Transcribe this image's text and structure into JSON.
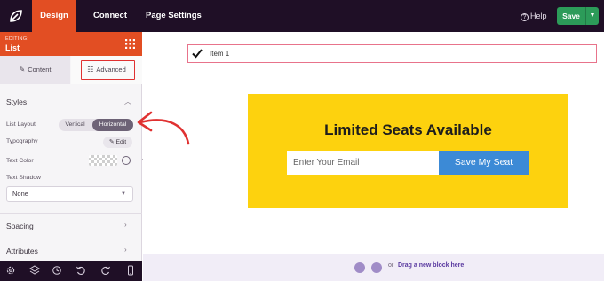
{
  "topbar": {
    "tabs": [
      {
        "label": "Design",
        "active": true
      },
      {
        "label": "Connect",
        "active": false
      },
      {
        "label": "Page Settings",
        "active": false
      }
    ],
    "help_label": "Help",
    "save_label": "Save"
  },
  "sidebar": {
    "editing_label": "EDITING:",
    "editing_title": "List",
    "tabs": {
      "content": "Content",
      "advanced": "Advanced"
    },
    "sections": {
      "styles": "Styles",
      "spacing": "Spacing",
      "attributes": "Attributes"
    },
    "rows": {
      "list_layout": "List Layout",
      "typography": "Typography",
      "text_color": "Text Color",
      "text_shadow": "Text Shadow"
    },
    "layout_options": [
      "Vertical",
      "Horizontal"
    ],
    "layout_selected": "Horizontal",
    "edit_label": "Edit",
    "text_shadow_value": "None"
  },
  "canvas": {
    "list_item": "Item 1",
    "promo": {
      "heading": "Limited Seats Available",
      "email_placeholder": "Enter Your Email",
      "button_label": "Save My Seat"
    },
    "drop_zone": {
      "or": "or",
      "text": "Drag a new block here"
    }
  },
  "colors": {
    "topbar": "#1f0f26",
    "accent": "#e24e23",
    "promo_bg": "#fdd20e",
    "button": "#3c8ad6",
    "save": "#2c9b59",
    "highlight": "#e03131"
  }
}
